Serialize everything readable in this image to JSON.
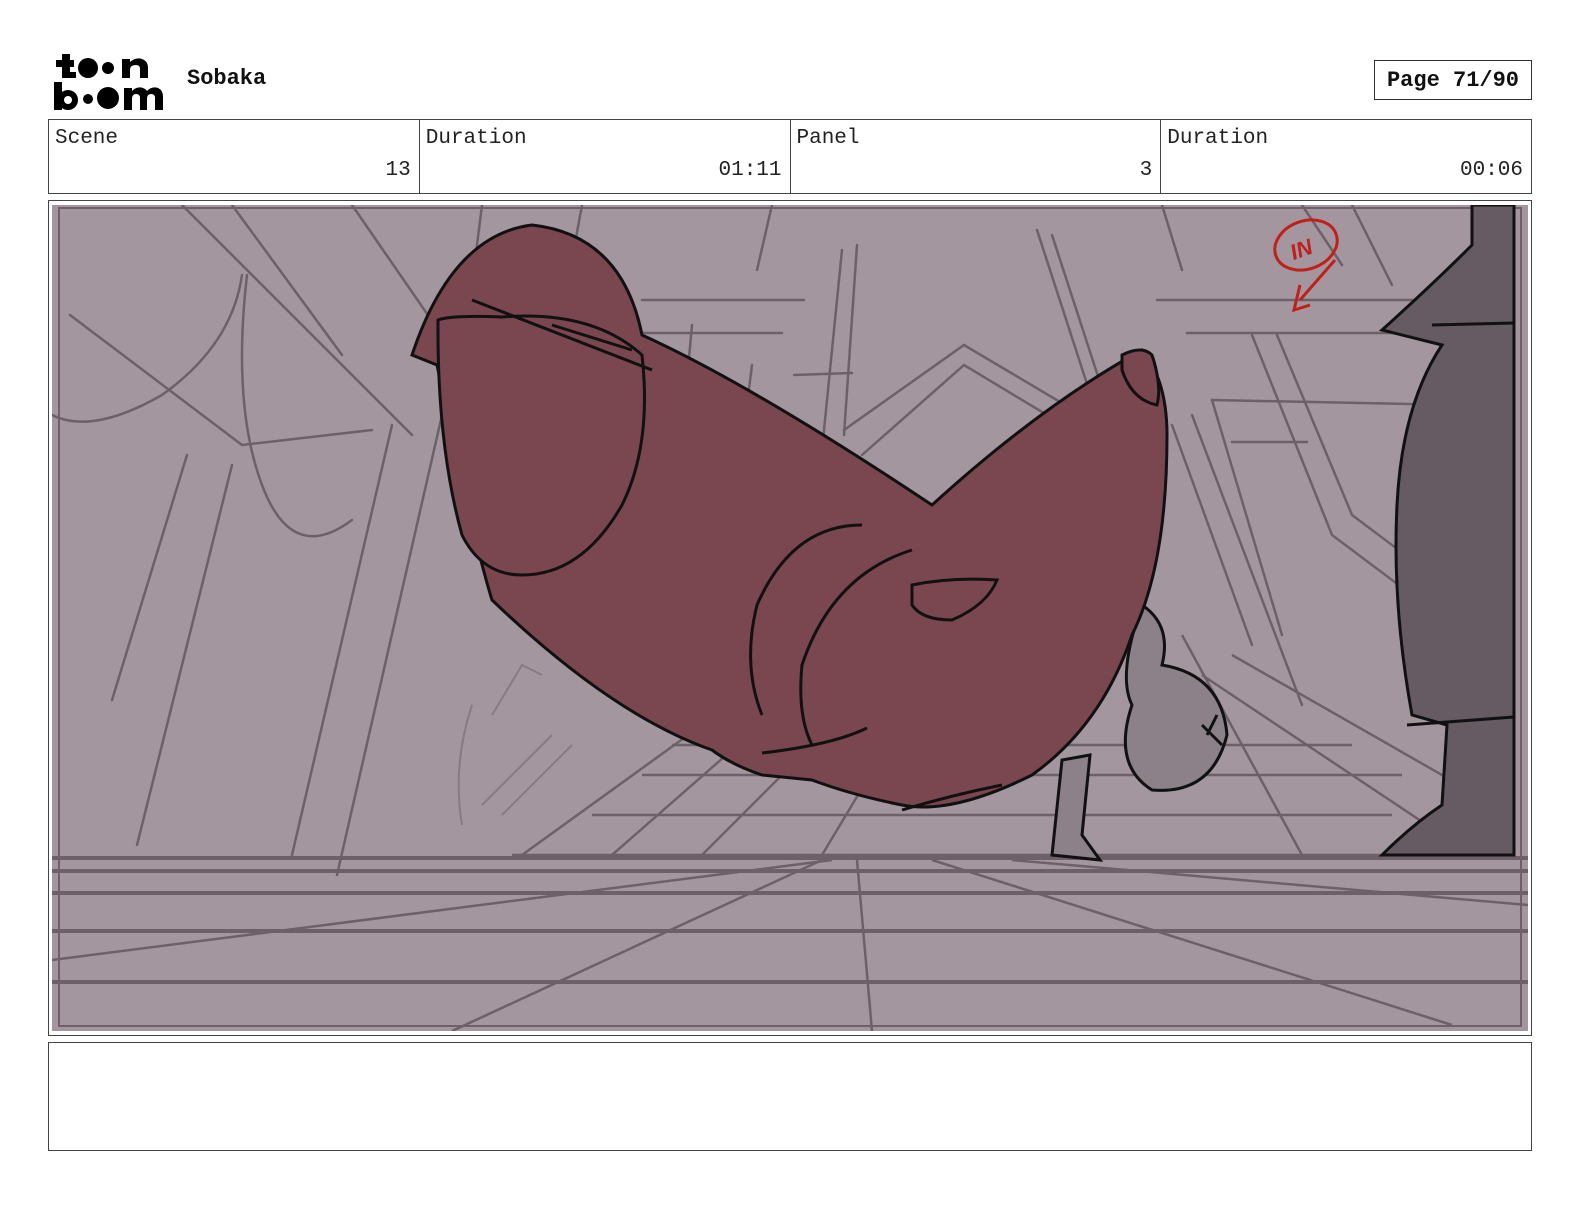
{
  "header": {
    "logo_lines": [
      "toon",
      "boom"
    ],
    "project_title": "Sobaka",
    "page_label": "Page 71/90"
  },
  "info": [
    {
      "label": "Scene",
      "value": "13"
    },
    {
      "label": "Duration",
      "value": "01:11"
    },
    {
      "label": "Panel",
      "value": "3"
    },
    {
      "label": "Duration",
      "value": "00:06"
    }
  ],
  "panel": {
    "annotation": "IN",
    "colors": {
      "background": "#a4969f",
      "character": "#7a4750",
      "right_figure": "#665a63",
      "line": "#6e6069",
      "annotation": "#c0201c"
    }
  },
  "notes": {
    "text": ""
  }
}
